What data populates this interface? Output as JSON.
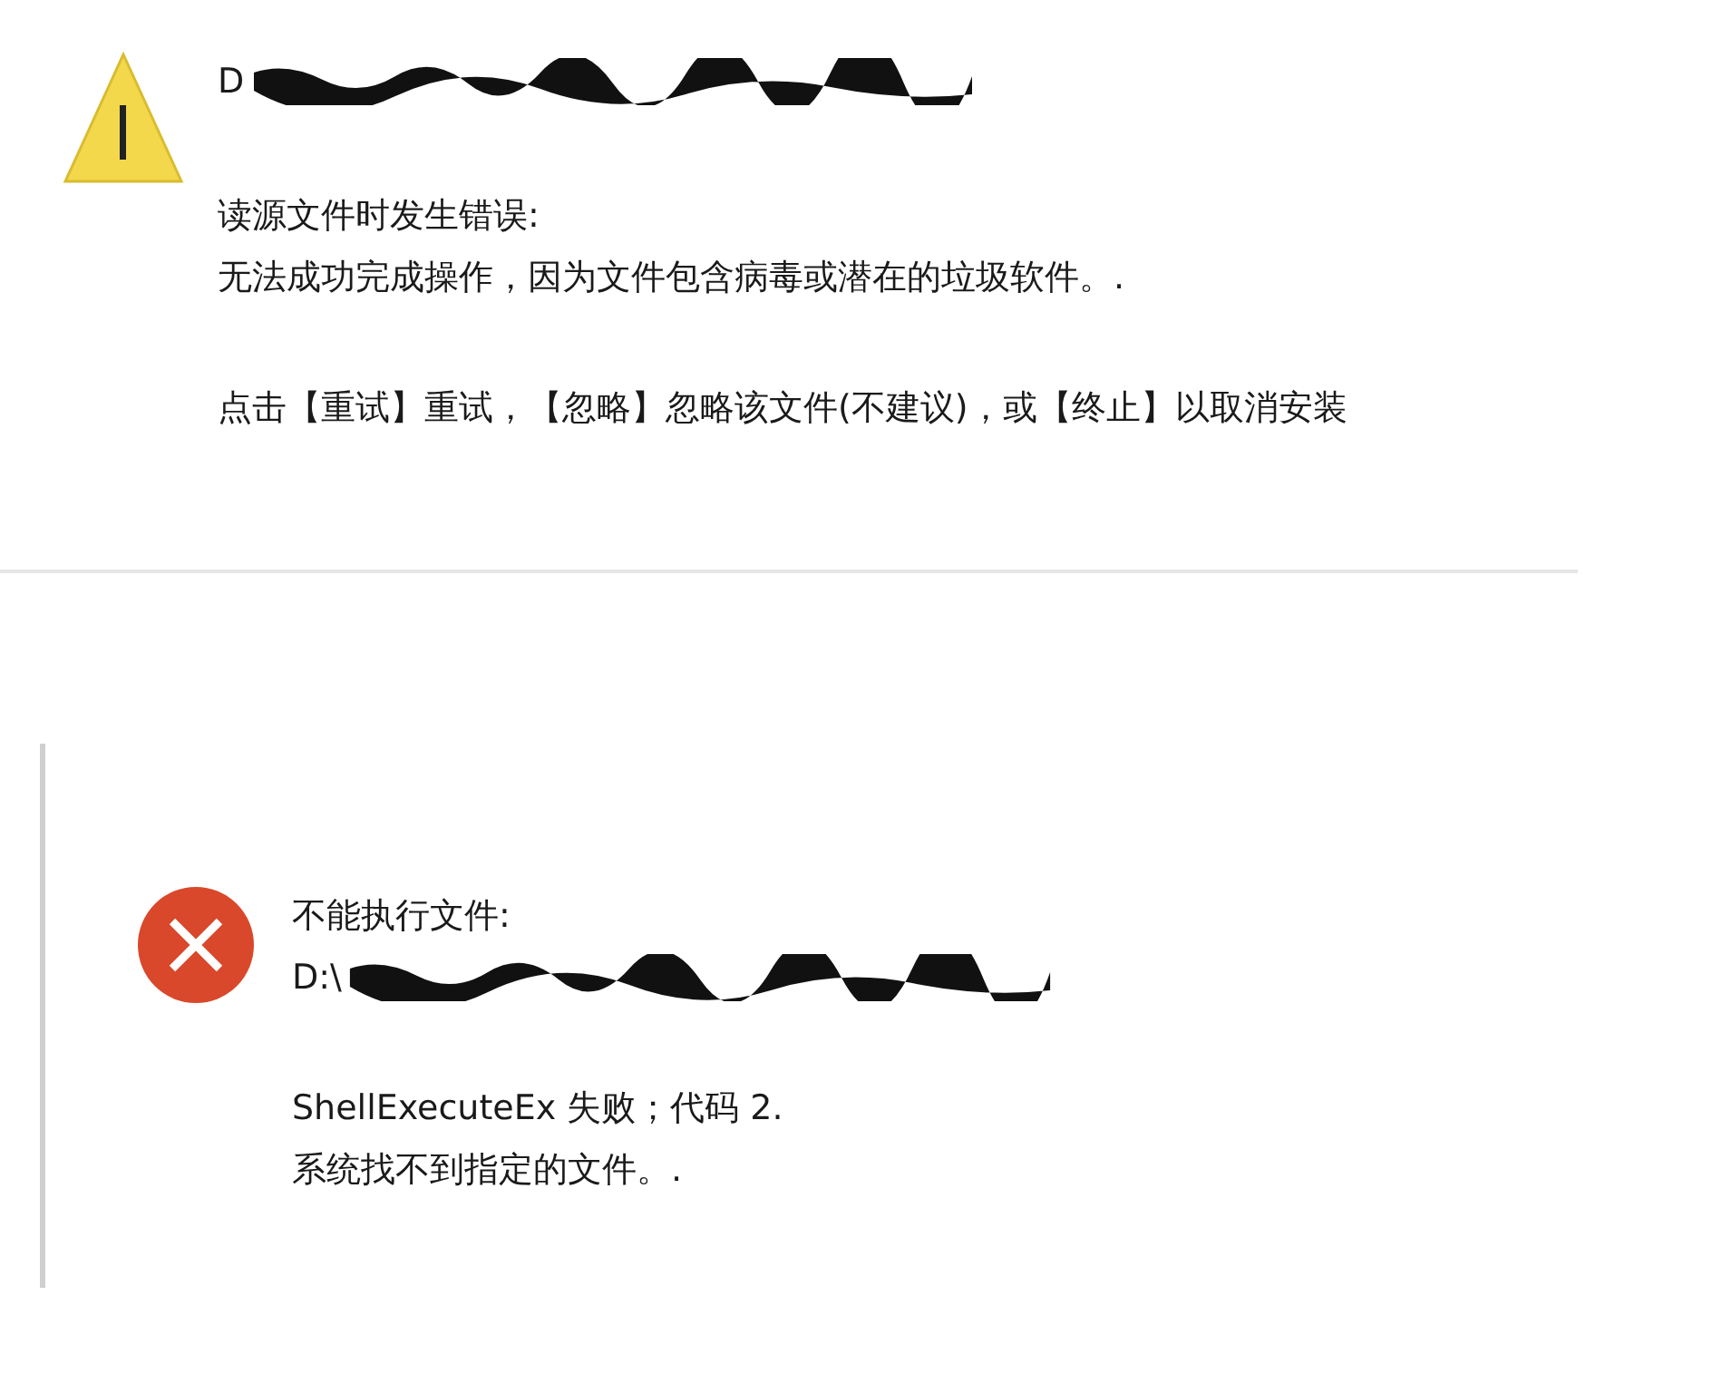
{
  "dialogs": [
    {
      "kind": "warning",
      "path": "D",
      "paragraphs": [
        [
          "读源文件时发生错误:",
          "无法成功完成操作，因为文件包含病毒或潜在的垃圾软件。."
        ],
        [
          "点击【重试】重试，【忽略】忽略该文件(不建议)，或【终止】以取消安装"
        ]
      ]
    },
    {
      "kind": "error",
      "heading": "不能执行文件:",
      "path": "D:\\",
      "paragraphs": [
        [
          "ShellExecuteEx 失败；代码 2.",
          "系统找不到指定的文件。."
        ]
      ]
    }
  ]
}
